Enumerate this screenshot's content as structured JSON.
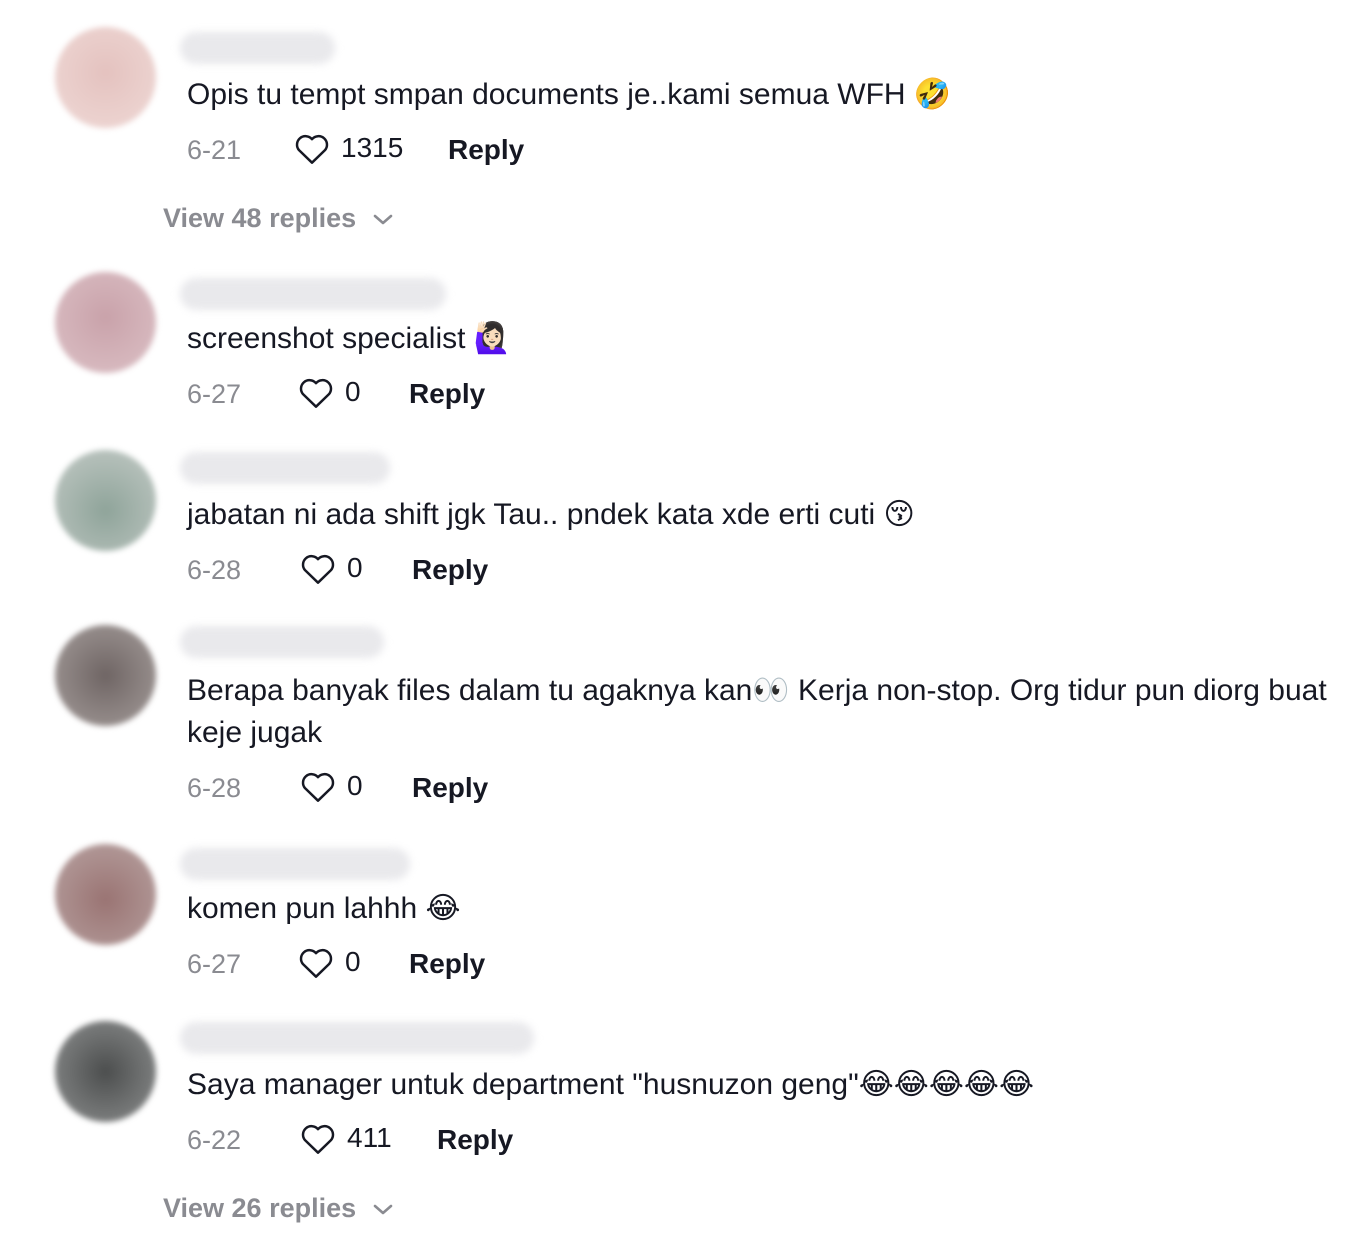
{
  "comments": [
    {
      "text": "Opis tu tempt smpan documents je..kami semua WFH 🤣",
      "date": "6-21",
      "likes": "1315",
      "reply_label": "Reply",
      "view_replies": "View 48 replies"
    },
    {
      "text": "screenshot specialist 🙋🏻‍♀️",
      "date": "6-27",
      "likes": "0",
      "reply_label": "Reply"
    },
    {
      "text": "jabatan ni ada shift jgk Tau.. pndek kata xde erti cuti 😚",
      "date": "6-28",
      "likes": "0",
      "reply_label": "Reply"
    },
    {
      "text": "Berapa banyak files dalam tu agaknya kan👀 Kerja non-stop. Org tidur pun diorg buat keje jugak",
      "date": "6-28",
      "likes": "0",
      "reply_label": "Reply"
    },
    {
      "text": "komen pun lahhh 😂",
      "date": "6-27",
      "likes": "0",
      "reply_label": "Reply"
    },
    {
      "text": "Saya manager untuk department \"husnuzon geng\"😂😂😂😂😂",
      "date": "6-22",
      "likes": "411",
      "reply_label": "Reply",
      "view_replies": "View 26 replies"
    }
  ],
  "colors": {
    "text": "#161823",
    "secondary": "#8a8b91",
    "avatar_1": "#e8c9c6",
    "avatar_2": "#d8b5bb",
    "avatar_3": "#a9b7b1",
    "avatar_4": "#8f8785",
    "avatar_5": "#a88a88",
    "avatar_6": "#6f7171"
  },
  "icons": {
    "like": "heart-outline-icon",
    "expand": "chevron-down-icon"
  }
}
